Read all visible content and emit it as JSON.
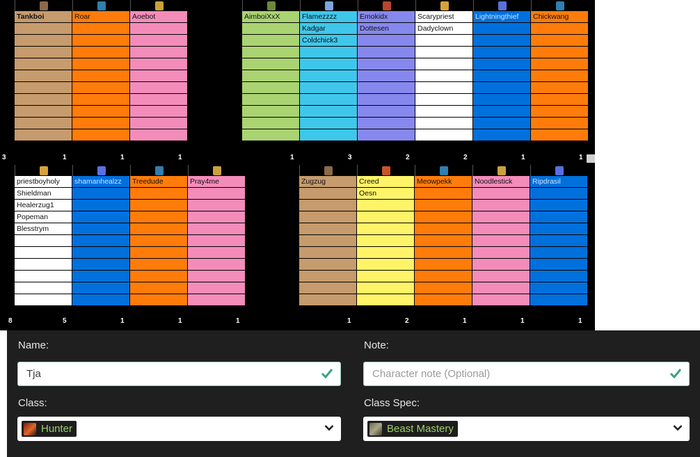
{
  "colors": {
    "warrior": "#c69b6d",
    "druid": "#ff7c0a",
    "paladin": "#f48cba",
    "hunter": "#aad372",
    "mage": "#3fc7eb",
    "warlock": "#8788ee",
    "priest": "#ffffff",
    "shaman": "#0070dd",
    "rogue": "#fff468"
  },
  "top_left": {
    "columns": [
      {
        "icon": "warrior-icon",
        "class": "warrior",
        "names": [
          "Tankboi"
        ],
        "rows": 11
      },
      {
        "icon": "druid-bear-icon",
        "class": "druid",
        "names": [
          "Roar"
        ],
        "rows": 11
      },
      {
        "icon": "paladin-shield-icon",
        "class": "paladin",
        "names": [
          "Aoebot"
        ],
        "rows": 11
      }
    ],
    "counts": [
      "3",
      "1",
      "1",
      "1"
    ]
  },
  "top_right": {
    "columns": [
      {
        "icon": "hunter-icon",
        "class": "hunter",
        "names": [
          "AimboiXxX"
        ],
        "rows": 11
      },
      {
        "icon": "mage-icon",
        "class": "mage",
        "names": [
          "Flamezzzz",
          "Kadgar",
          "Coldchick3"
        ],
        "rows": 11
      },
      {
        "icon": "warlock-icon",
        "class": "warlock",
        "names": [
          "Emokidx",
          "Dottesen"
        ],
        "rows": 11
      },
      {
        "icon": "shadow-priest-icon",
        "class": "priest",
        "names": [
          "Scarypriest",
          "Dadyclown"
        ],
        "rows": 11
      },
      {
        "icon": "shaman-elemental-icon",
        "class": "shaman",
        "names": [
          "Lightningthief"
        ],
        "rows": 11
      },
      {
        "icon": "druid-moonkin-icon",
        "class": "druid",
        "names": [
          "Chickwang"
        ],
        "rows": 11
      }
    ],
    "counts": [
      "1",
      "3",
      "2",
      "2",
      "1",
      "1"
    ]
  },
  "bottom_left": {
    "columns": [
      {
        "icon": "holy-priest-icon",
        "class": "priest",
        "names": [
          "priestboyholy",
          "Shieldman",
          "Healerzug1",
          "Popeman",
          "Blesstrym"
        ],
        "rows": 11
      },
      {
        "icon": "shaman-resto-icon",
        "class": "shaman",
        "names": [
          "shamanhealzz"
        ],
        "rows": 11
      },
      {
        "icon": "druid-resto-icon",
        "class": "druid",
        "names": [
          "Treedude"
        ],
        "rows": 11
      },
      {
        "icon": "holy-paladin-icon",
        "class": "paladin",
        "names": [
          "Pray4me"
        ],
        "rows": 11
      }
    ],
    "counts": [
      "8",
      "5",
      "1",
      "1",
      "1"
    ]
  },
  "bottom_right": {
    "columns": [
      {
        "icon": "warrior-fury-icon",
        "class": "warrior",
        "names": [
          "Zugzug"
        ],
        "rows": 11
      },
      {
        "icon": "rogue-icon",
        "class": "rogue",
        "names": [
          "Creed",
          "Oesn"
        ],
        "rows": 11
      },
      {
        "icon": "druid-cat-icon",
        "class": "druid",
        "names": [
          "Meowpekk"
        ],
        "rows": 11
      },
      {
        "icon": "paladin-ret-icon",
        "class": "paladin",
        "names": [
          "Noodlestick"
        ],
        "rows": 11
      },
      {
        "icon": "shaman-enh-icon",
        "class": "shaman",
        "names": [
          "Ripdrasil"
        ],
        "rows": 11
      }
    ],
    "counts": [
      "1",
      "2",
      "1",
      "1",
      "1"
    ]
  },
  "form": {
    "name_label": "Name:",
    "name_value": "Tja",
    "note_label": "Note:",
    "note_placeholder": "Character note (Optional)",
    "class_label": "Class:",
    "class_value": "Hunter",
    "class_icon": "hunter-icon",
    "spec_label": "Class Spec:",
    "spec_value": "Beast Mastery",
    "spec_icon": "beast-mastery-icon"
  }
}
